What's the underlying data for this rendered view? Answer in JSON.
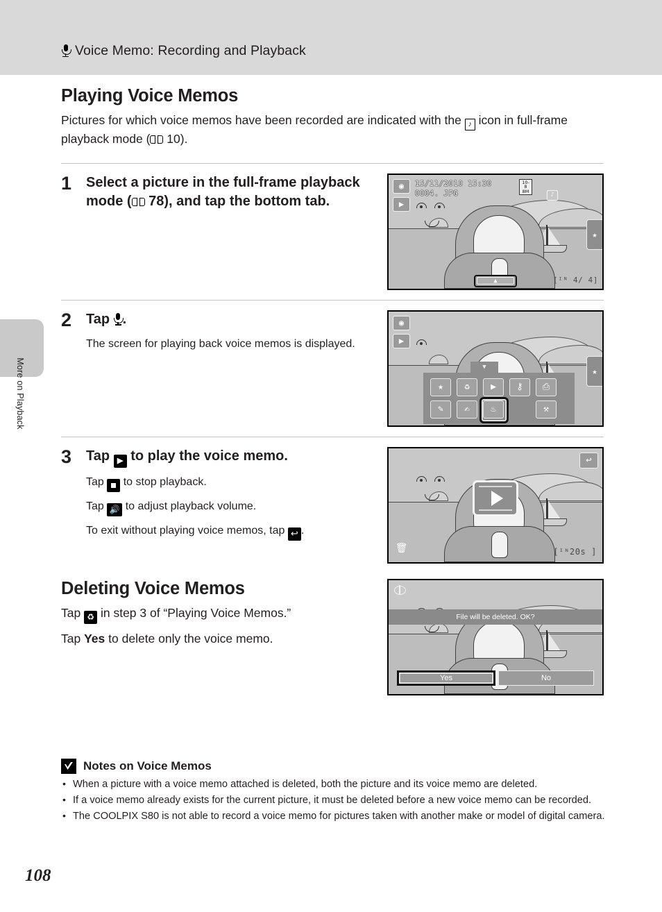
{
  "header": {
    "icon": "microphone-icon",
    "title": "Voice Memo: Recording and Playback"
  },
  "sidebar": {
    "chapter_label": "More on Playback"
  },
  "page_number": "108",
  "section": {
    "title": "Playing Voice Memos",
    "lead_part1": "Pictures for which voice memos have been recorded are indicated with the",
    "lead_icon": "voice-memo-icon",
    "lead_part2": "icon in full-frame playback mode (",
    "lead_book_icon": "book-reference-icon",
    "lead_page_ref": "10).",
    "lead_full": "Pictures for which voice memos have been recorded are indicated with the [memo] icon in full-frame playback mode (A 10)."
  },
  "steps": [
    {
      "number": "1",
      "head_part1": "Select a picture in the full-frame playback mode (",
      "head_page_ref": "78), and tap the bottom tab.",
      "head_full": "Select a picture in the full-frame playback mode (A 78), and tap the bottom tab."
    },
    {
      "number": "2",
      "head_prefix": "Tap",
      "head_suffix": ".",
      "sub": "The screen for playing back voice memos is displayed."
    },
    {
      "number": "3",
      "head_prefix": "Tap",
      "head_suffix": "to play the voice memo.",
      "line1_prefix": "Tap",
      "line1_suffix": "to stop playback.",
      "line2_prefix": "Tap",
      "line2_suffix": "to adjust playback volume.",
      "line3_prefix": "To exit without playing voice memos, tap",
      "line3_suffix": "."
    }
  ],
  "screens": {
    "screen1": {
      "date": "15/11/2010",
      "time": "15:30",
      "filename": "0004. JPG",
      "quality_top": "10-8",
      "quality_bottom": "8M",
      "memo_indicator": "voice-memo-icon",
      "counter": "[ᴵᴺ    4/    4]",
      "bottom_tab_glyph": "▲",
      "right_tab_glyph": "★",
      "mode_icon_top": "camera-icon",
      "mode_icon_bottom": "playback-icon"
    },
    "screen2": {
      "mode_icon_top": "camera-icon",
      "mode_icon_bottom": "playback-icon",
      "right_tab_glyph": "★",
      "menu_items": [
        {
          "name": "favorites-folder-icon",
          "glyph": "★",
          "selected": false
        },
        {
          "name": "delete-trash-icon",
          "glyph": "🗑",
          "selected": false
        },
        {
          "name": "slideshow-icon",
          "glyph": "▶",
          "selected": false
        },
        {
          "name": "protect-key-icon",
          "glyph": "⚷",
          "selected": false
        },
        {
          "name": "print-order-icon",
          "glyph": "⎙",
          "selected": false
        },
        {
          "name": "quick-retouch-icon",
          "glyph": "✎",
          "selected": false
        },
        {
          "name": "edit-image-icon",
          "glyph": "✐",
          "selected": false
        },
        {
          "name": "voice-memo-icon",
          "glyph": "♁",
          "selected": true
        },
        {
          "name": "setup-wrench-icon",
          "glyph": "⚒",
          "selected": false
        }
      ]
    },
    "screen3": {
      "back_glyph": "↩",
      "trash_glyph": "🗑",
      "play_glyph": "▶",
      "duration": "[ᴵᴺ20s ]"
    },
    "screen4": {
      "message": "File will be deleted. OK?",
      "yes_label": "Yes",
      "no_label": "No"
    }
  },
  "deleting": {
    "title": "Deleting Voice Memos",
    "line1_prefix": "Tap",
    "line1_suffix": "in step 3 of “Playing Voice Memos.”",
    "line2_prefix": "Tap",
    "line2_bold": "Yes",
    "line2_suffix": "to delete only the voice memo."
  },
  "notes": {
    "title": "Notes on Voice Memos",
    "items": [
      "When a picture with a voice memo attached is deleted, both the picture and its voice memo are deleted.",
      "If a voice memo already exists for the current picture, it must be deleted before a new voice memo can be recorded.",
      "The COOLPIX S80 is not able to record a voice memo for pictures taken with another make or model of digital camera."
    ]
  },
  "colors": {
    "header_bg": "#d9d9d9",
    "side_tab": "#c9c9c9",
    "rule": "#c4c4c4",
    "text": "#231f20"
  }
}
